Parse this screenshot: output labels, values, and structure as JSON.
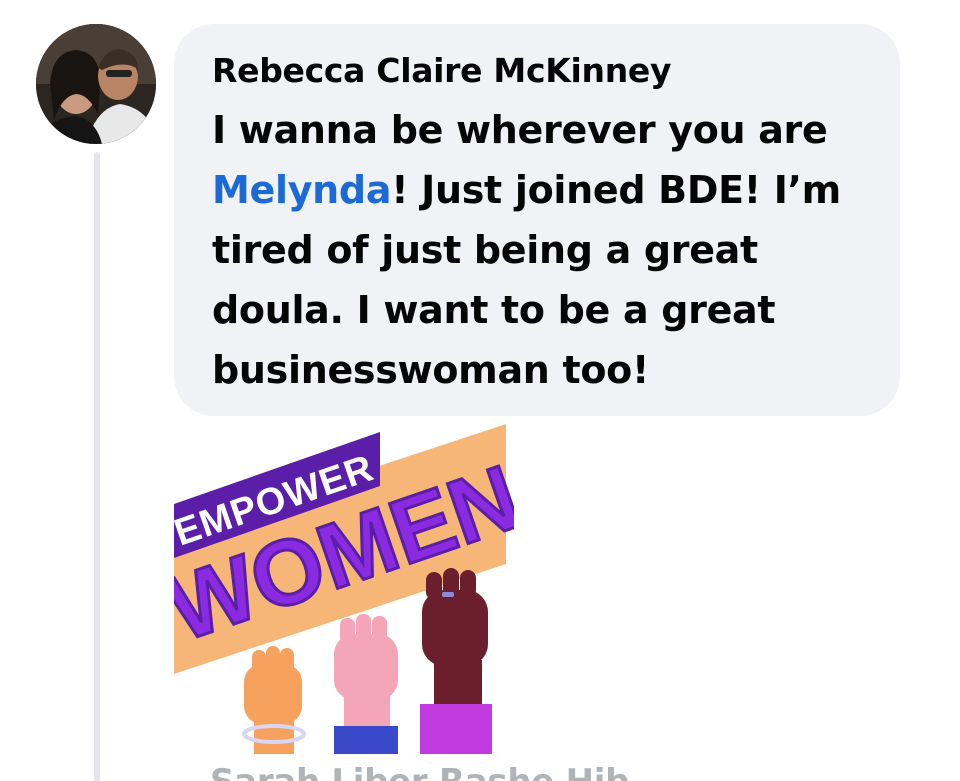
{
  "comment": {
    "author": "Rebecca Claire McKinney",
    "text_line1": "I wanna be wherever you are",
    "mention": "Melynda",
    "text_line2_rest": "! Just joined BDE! I’m",
    "text_line3": "tired of just being a great",
    "text_line4": "doula. I want to be a great",
    "text_line5": "businesswoman too!"
  },
  "sticker": {
    "top_word": "EMPOWER",
    "main_word": "WOMEN",
    "colors": {
      "banner": "#f6b677",
      "purple_dark": "#5a1ea8",
      "purple": "#8a2be2",
      "magenta": "#c13ae0"
    }
  },
  "next_comment": {
    "author_partial": "Sarah Liber Rashe Hib"
  },
  "colors": {
    "bubble": "#f0f2f5",
    "mention": "#1b6ad6",
    "thread_line": "#e4e6eb"
  }
}
